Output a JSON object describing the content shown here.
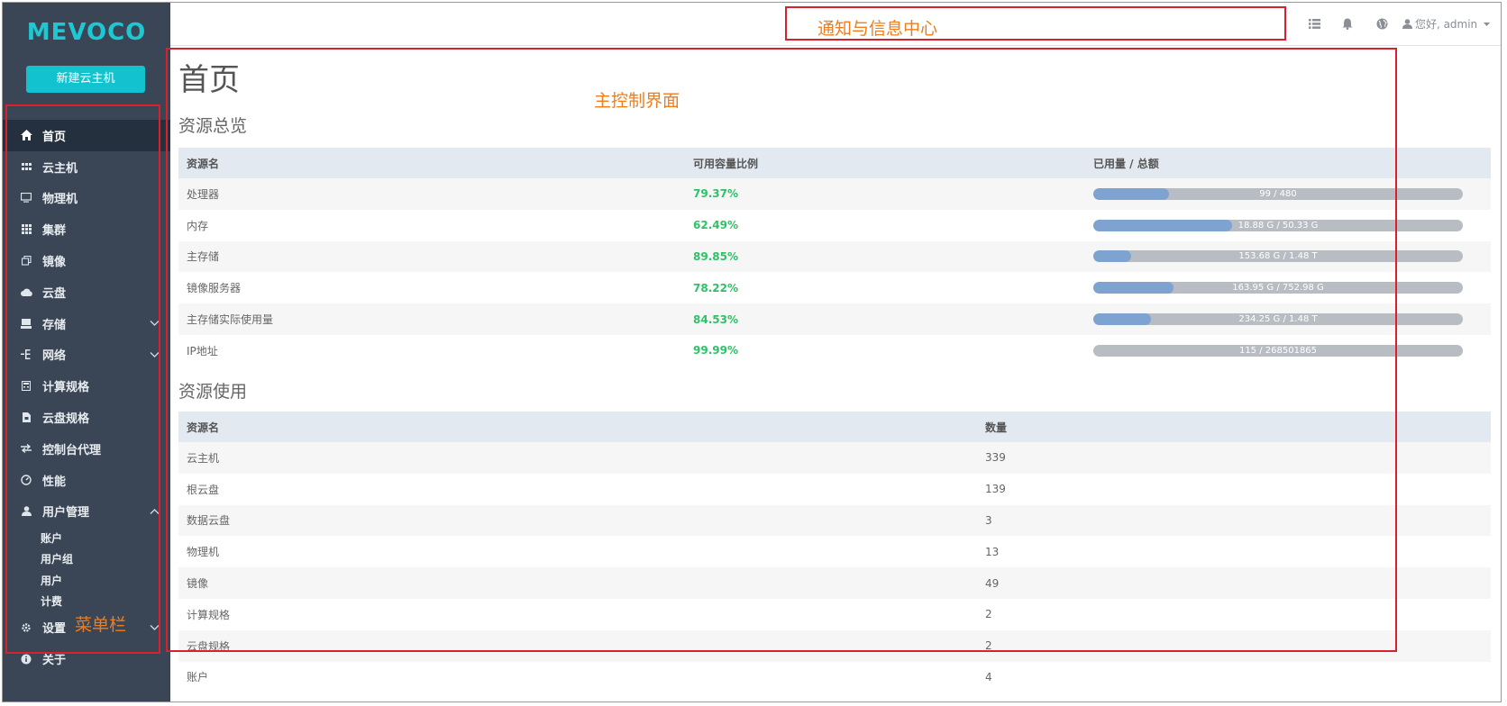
{
  "brand": {
    "logo": "MEVOCO",
    "new_vm_button": "新建云主机"
  },
  "nav": {
    "items": [
      {
        "label": "首页",
        "icon": "home-icon"
      },
      {
        "label": "云主机",
        "icon": "grid-small-icon"
      },
      {
        "label": "物理机",
        "icon": "monitor-icon"
      },
      {
        "label": "集群",
        "icon": "grid-icon"
      },
      {
        "label": "镜像",
        "icon": "copy-icon"
      },
      {
        "label": "云盘",
        "icon": "cloud-icon"
      },
      {
        "label": "存储",
        "icon": "storage-icon"
      },
      {
        "label": "网络",
        "icon": "network-icon"
      },
      {
        "label": "计算规格",
        "icon": "calculator-icon"
      },
      {
        "label": "云盘规格",
        "icon": "file-icon"
      },
      {
        "label": "控制台代理",
        "icon": "transfer-icon"
      },
      {
        "label": "性能",
        "icon": "dashboard-icon"
      },
      {
        "label": "用户管理",
        "icon": "user-icon"
      },
      {
        "label": "设置",
        "icon": "gear-icon"
      },
      {
        "label": "关于",
        "icon": "info-icon"
      }
    ],
    "user_mgmt_sub": [
      "账户",
      "用户组",
      "用户",
      "计费"
    ]
  },
  "topbar": {
    "user_label": "您好, admin",
    "icons": [
      "list-icon",
      "bell-icon",
      "globe-icon",
      "user-icon"
    ]
  },
  "annotations": {
    "notify": "通知与信息中心",
    "main": "主控制界面",
    "menu": "菜单栏"
  },
  "main": {
    "title": "首页",
    "overview": {
      "title": "资源总览",
      "headers": [
        "资源名",
        "可用容量比例",
        "已用量 / 总额"
      ],
      "rows": [
        {
          "name": "处理器",
          "pct": "79.37%",
          "usage": "99 / 480",
          "fill": 0.206
        },
        {
          "name": "内存",
          "pct": "62.49%",
          "usage": "18.88 G / 50.33 G",
          "fill": 0.375
        },
        {
          "name": "主存储",
          "pct": "89.85%",
          "usage": "153.68 G / 1.48 T",
          "fill": 0.102
        },
        {
          "name": "镜像服务器",
          "pct": "78.22%",
          "usage": "163.95 G / 752.98 G",
          "fill": 0.218
        },
        {
          "name": "主存储实际使用量",
          "pct": "84.53%",
          "usage": "234.25 G / 1.48 T",
          "fill": 0.155
        },
        {
          "name": "IP地址",
          "pct": "99.99%",
          "usage": "115 / 268501865",
          "fill": 0.0
        }
      ]
    },
    "usage": {
      "title": "资源使用",
      "headers": [
        "资源名",
        "数量"
      ],
      "rows": [
        {
          "name": "云主机",
          "count": "339"
        },
        {
          "name": "根云盘",
          "count": "139"
        },
        {
          "name": "数据云盘",
          "count": "3"
        },
        {
          "name": "物理机",
          "count": "13"
        },
        {
          "name": "镜像",
          "count": "49"
        },
        {
          "name": "计算规格",
          "count": "2"
        },
        {
          "name": "云盘规格",
          "count": "2"
        },
        {
          "name": "账户",
          "count": "4"
        }
      ]
    }
  }
}
